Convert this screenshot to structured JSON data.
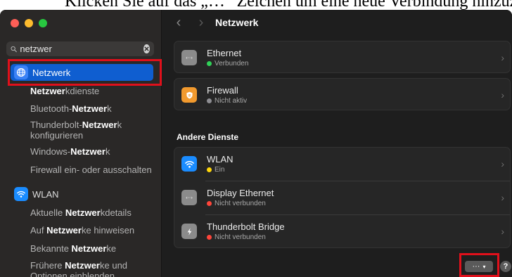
{
  "caption": {
    "text": "Klicken Sie auf das „…“ Zeichen um eine neue Verbindung hinzuzufügen"
  },
  "search": {
    "value": "netzwer"
  },
  "sidebar": {
    "selected": {
      "label_bold": "Netzwer",
      "label_rest": "k"
    },
    "subitems": [
      {
        "pre": "",
        "bold": "Netzwer",
        "post": "kdienste"
      },
      {
        "pre": "Bluetooth-",
        "bold": "Netzwer",
        "post": "k"
      },
      {
        "pre": "Thunderbolt-",
        "bold": "Netzwer",
        "post": "k",
        "line2": "konfigurieren"
      },
      {
        "pre": "Windows-",
        "bold": "Netzwer",
        "post": "k"
      },
      {
        "pre": "Firewall ein- oder ausschalten",
        "bold": "",
        "post": ""
      }
    ],
    "wlan_label": "WLAN",
    "wlan_subitems": [
      {
        "pre": "Aktuelle ",
        "bold": "Netzwer",
        "post": "kdetails"
      },
      {
        "pre": "Auf ",
        "bold": "Netzwer",
        "post": "ke hinweisen"
      },
      {
        "pre": "Bekannte ",
        "bold": "Netzwer",
        "post": "ke"
      },
      {
        "pre": "Frühere ",
        "bold": "Netzwer",
        "post": "ke und",
        "line2": "Optionen einblenden"
      }
    ]
  },
  "main": {
    "title": "Netzwerk",
    "section_title": "Andere Dienste",
    "services_top": [
      {
        "name": "Ethernet",
        "status": "Verbunden",
        "status_color": "#30d158",
        "icon": "ethernet-icon"
      },
      {
        "name": "Firewall",
        "status": "Nicht aktiv",
        "status_color": "#8e8e93",
        "icon": "firewall-icon"
      }
    ],
    "services_other": [
      {
        "name": "WLAN",
        "status": "Ein",
        "status_color": "#ffd60a",
        "icon": "wifi-icon"
      },
      {
        "name": "Display Ethernet",
        "status": "Nicht verbunden",
        "status_color": "#ff453a",
        "icon": "ethernet-icon"
      },
      {
        "name": "Thunderbolt Bridge",
        "status": "Nicht verbunden",
        "status_color": "#ff453a",
        "icon": "thunderbolt-icon"
      }
    ],
    "more_label": "···",
    "help_label": "?"
  },
  "colors": {
    "accent": "#0f5ed0",
    "highlight_box": "#e0101b"
  }
}
